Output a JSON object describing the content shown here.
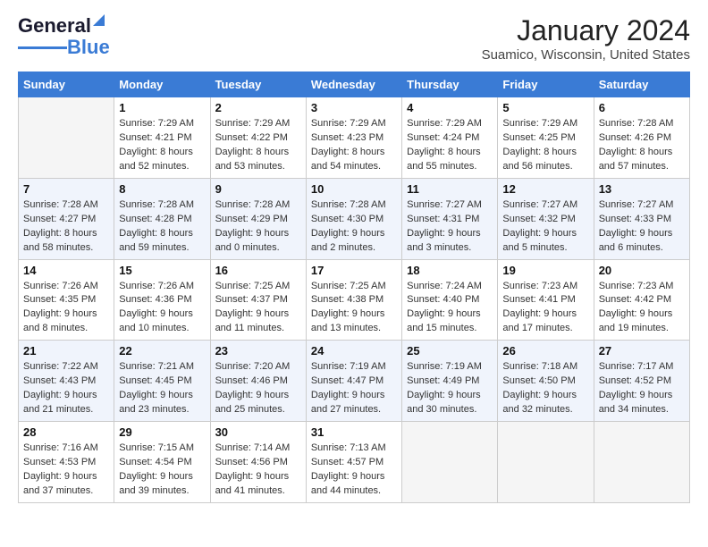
{
  "header": {
    "logo": {
      "line1": "General",
      "line2": "Blue"
    },
    "title": "January 2024",
    "subtitle": "Suamico, Wisconsin, United States"
  },
  "calendar": {
    "days_of_week": [
      "Sunday",
      "Monday",
      "Tuesday",
      "Wednesday",
      "Thursday",
      "Friday",
      "Saturday"
    ],
    "weeks": [
      [
        {
          "day": "",
          "content": ""
        },
        {
          "day": "1",
          "content": "Sunrise: 7:29 AM\nSunset: 4:21 PM\nDaylight: 8 hours\nand 52 minutes."
        },
        {
          "day": "2",
          "content": "Sunrise: 7:29 AM\nSunset: 4:22 PM\nDaylight: 8 hours\nand 53 minutes."
        },
        {
          "day": "3",
          "content": "Sunrise: 7:29 AM\nSunset: 4:23 PM\nDaylight: 8 hours\nand 54 minutes."
        },
        {
          "day": "4",
          "content": "Sunrise: 7:29 AM\nSunset: 4:24 PM\nDaylight: 8 hours\nand 55 minutes."
        },
        {
          "day": "5",
          "content": "Sunrise: 7:29 AM\nSunset: 4:25 PM\nDaylight: 8 hours\nand 56 minutes."
        },
        {
          "day": "6",
          "content": "Sunrise: 7:28 AM\nSunset: 4:26 PM\nDaylight: 8 hours\nand 57 minutes."
        }
      ],
      [
        {
          "day": "7",
          "content": "Sunrise: 7:28 AM\nSunset: 4:27 PM\nDaylight: 8 hours\nand 58 minutes."
        },
        {
          "day": "8",
          "content": "Sunrise: 7:28 AM\nSunset: 4:28 PM\nDaylight: 8 hours\nand 59 minutes."
        },
        {
          "day": "9",
          "content": "Sunrise: 7:28 AM\nSunset: 4:29 PM\nDaylight: 9 hours\nand 0 minutes."
        },
        {
          "day": "10",
          "content": "Sunrise: 7:28 AM\nSunset: 4:30 PM\nDaylight: 9 hours\nand 2 minutes."
        },
        {
          "day": "11",
          "content": "Sunrise: 7:27 AM\nSunset: 4:31 PM\nDaylight: 9 hours\nand 3 minutes."
        },
        {
          "day": "12",
          "content": "Sunrise: 7:27 AM\nSunset: 4:32 PM\nDaylight: 9 hours\nand 5 minutes."
        },
        {
          "day": "13",
          "content": "Sunrise: 7:27 AM\nSunset: 4:33 PM\nDaylight: 9 hours\nand 6 minutes."
        }
      ],
      [
        {
          "day": "14",
          "content": "Sunrise: 7:26 AM\nSunset: 4:35 PM\nDaylight: 9 hours\nand 8 minutes."
        },
        {
          "day": "15",
          "content": "Sunrise: 7:26 AM\nSunset: 4:36 PM\nDaylight: 9 hours\nand 10 minutes."
        },
        {
          "day": "16",
          "content": "Sunrise: 7:25 AM\nSunset: 4:37 PM\nDaylight: 9 hours\nand 11 minutes."
        },
        {
          "day": "17",
          "content": "Sunrise: 7:25 AM\nSunset: 4:38 PM\nDaylight: 9 hours\nand 13 minutes."
        },
        {
          "day": "18",
          "content": "Sunrise: 7:24 AM\nSunset: 4:40 PM\nDaylight: 9 hours\nand 15 minutes."
        },
        {
          "day": "19",
          "content": "Sunrise: 7:23 AM\nSunset: 4:41 PM\nDaylight: 9 hours\nand 17 minutes."
        },
        {
          "day": "20",
          "content": "Sunrise: 7:23 AM\nSunset: 4:42 PM\nDaylight: 9 hours\nand 19 minutes."
        }
      ],
      [
        {
          "day": "21",
          "content": "Sunrise: 7:22 AM\nSunset: 4:43 PM\nDaylight: 9 hours\nand 21 minutes."
        },
        {
          "day": "22",
          "content": "Sunrise: 7:21 AM\nSunset: 4:45 PM\nDaylight: 9 hours\nand 23 minutes."
        },
        {
          "day": "23",
          "content": "Sunrise: 7:20 AM\nSunset: 4:46 PM\nDaylight: 9 hours\nand 25 minutes."
        },
        {
          "day": "24",
          "content": "Sunrise: 7:19 AM\nSunset: 4:47 PM\nDaylight: 9 hours\nand 27 minutes."
        },
        {
          "day": "25",
          "content": "Sunrise: 7:19 AM\nSunset: 4:49 PM\nDaylight: 9 hours\nand 30 minutes."
        },
        {
          "day": "26",
          "content": "Sunrise: 7:18 AM\nSunset: 4:50 PM\nDaylight: 9 hours\nand 32 minutes."
        },
        {
          "day": "27",
          "content": "Sunrise: 7:17 AM\nSunset: 4:52 PM\nDaylight: 9 hours\nand 34 minutes."
        }
      ],
      [
        {
          "day": "28",
          "content": "Sunrise: 7:16 AM\nSunset: 4:53 PM\nDaylight: 9 hours\nand 37 minutes."
        },
        {
          "day": "29",
          "content": "Sunrise: 7:15 AM\nSunset: 4:54 PM\nDaylight: 9 hours\nand 39 minutes."
        },
        {
          "day": "30",
          "content": "Sunrise: 7:14 AM\nSunset: 4:56 PM\nDaylight: 9 hours\nand 41 minutes."
        },
        {
          "day": "31",
          "content": "Sunrise: 7:13 AM\nSunset: 4:57 PM\nDaylight: 9 hours\nand 44 minutes."
        },
        {
          "day": "",
          "content": ""
        },
        {
          "day": "",
          "content": ""
        },
        {
          "day": "",
          "content": ""
        }
      ]
    ]
  }
}
